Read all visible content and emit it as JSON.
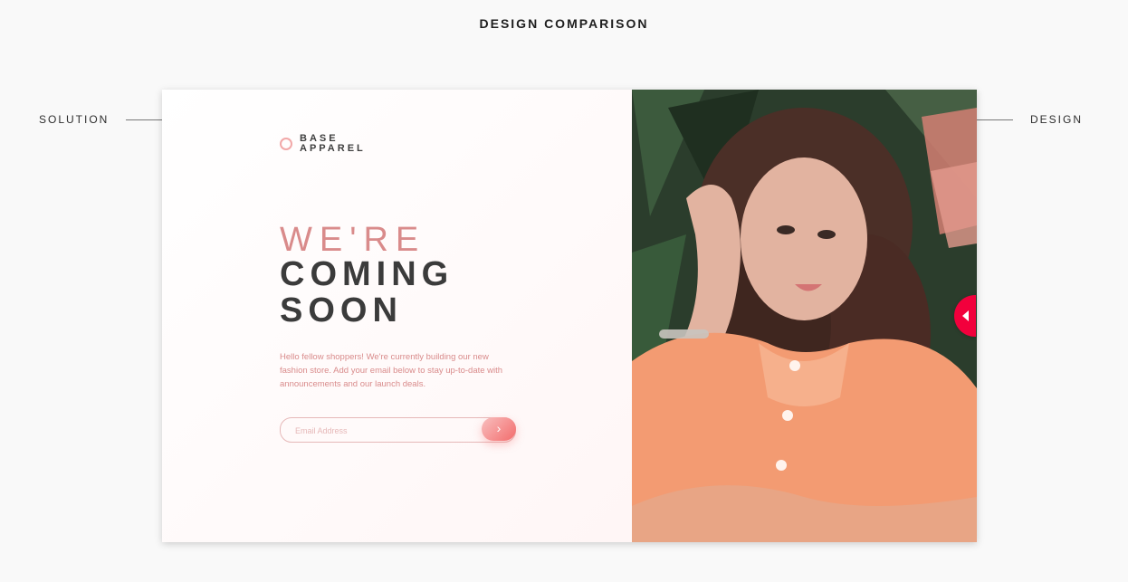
{
  "header": {
    "title": "DESIGN COMPARISON"
  },
  "labels": {
    "left": "SOLUTION",
    "right": "DESIGN"
  },
  "brand": {
    "line1": "BASE",
    "line2": "APPAREL"
  },
  "hero": {
    "line1": "WE'RE",
    "line2": "COMING",
    "line3": "SOON"
  },
  "description": "Hello fellow shoppers! We're currently building our new fashion store. Add your email below to stay up-to-date with announcements and our launch deals.",
  "form": {
    "email_placeholder": "Email Address"
  },
  "colors": {
    "accent_pink": "#d98b8b",
    "slider_red": "#f2003c",
    "text_dark": "#3b3b3b"
  }
}
